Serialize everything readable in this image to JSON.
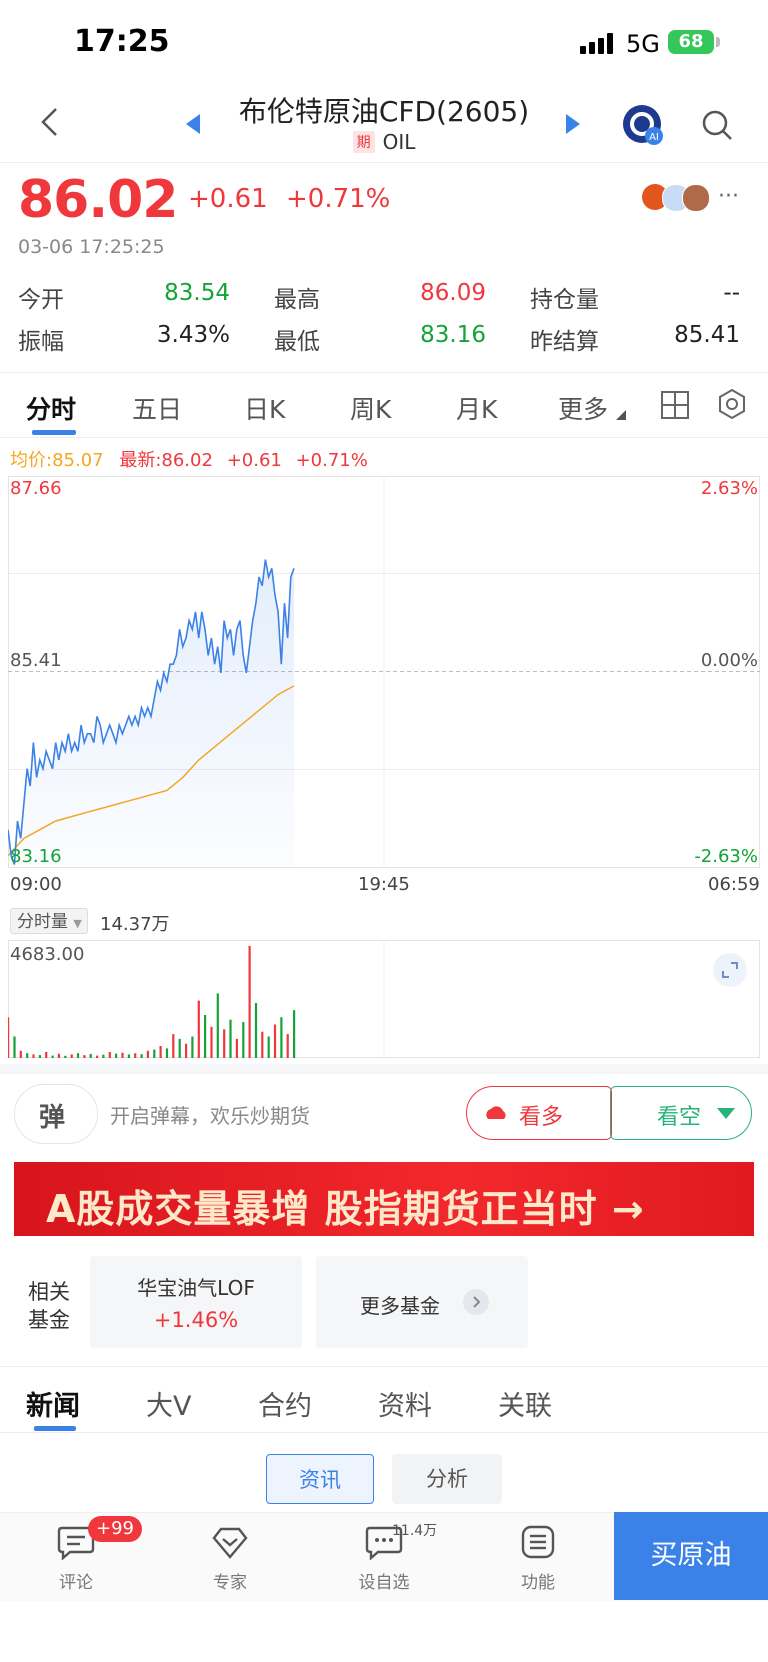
{
  "status_bar": {
    "time": "17:25",
    "network": "5G",
    "battery": "68"
  },
  "header": {
    "title": "布伦特原油CFD(2605)",
    "badge": "期",
    "code": "OIL"
  },
  "quote": {
    "price": "86.02",
    "change": "+0.61",
    "change_pct": "+0.71%",
    "time": "03-06 17:25:25",
    "stats": [
      {
        "label": "今开",
        "value": "83.54",
        "color": "#13a336"
      },
      {
        "label": "最高",
        "value": "86.09",
        "color": "#f0373c"
      },
      {
        "label": "持仓量",
        "value": "--",
        "color": "#222222"
      },
      {
        "label": "振幅",
        "value": "3.43%",
        "color": "#222222"
      },
      {
        "label": "最低",
        "value": "83.16",
        "color": "#13a336"
      },
      {
        "label": "昨结算",
        "value": "85.41",
        "color": "#222222"
      }
    ]
  },
  "chart_tabs": [
    "分时",
    "五日",
    "日K",
    "周K",
    "月K",
    "更多"
  ],
  "chart_legend": {
    "avg": "均价:85.07",
    "latest": "最新:86.02",
    "change": "+0.61",
    "change_pct": "+0.71%"
  },
  "chart_data": {
    "type": "line",
    "y_ticks_left": [
      "87.66",
      "85.41",
      "83.16"
    ],
    "y_ticks_right": [
      "2.63%",
      "0.00%",
      "-2.63%"
    ],
    "x_ticks": [
      "09:00",
      "19:45",
      "06:59"
    ],
    "ylim": [
      83.16,
      87.66
    ],
    "reference_line": 85.41,
    "series": [
      {
        "name": "最新",
        "color": "#3b82e8",
        "x": [
          0,
          1,
          2,
          3,
          4,
          5,
          6,
          7,
          8,
          9,
          10,
          11,
          12,
          13,
          14,
          15,
          16,
          17,
          18,
          19,
          20,
          21,
          22,
          23,
          24,
          25,
          26,
          27,
          28,
          29,
          30,
          31,
          32,
          33,
          34,
          35,
          36,
          37,
          38,
          39,
          40,
          41,
          42,
          43,
          44,
          45,
          46,
          47,
          48,
          49,
          50,
          51,
          52,
          53,
          54,
          55,
          56,
          57,
          58,
          59,
          60,
          61,
          62,
          63,
          64,
          65,
          66,
          67,
          68,
          69,
          70,
          71,
          72,
          73,
          74,
          75,
          76,
          77,
          78,
          79,
          80,
          81,
          82,
          83,
          84,
          85,
          86,
          87,
          88,
          89,
          90
        ],
        "values": [
          83.6,
          83.3,
          83.2,
          83.7,
          83.5,
          83.9,
          84.3,
          84.1,
          84.6,
          84.2,
          84.4,
          84.3,
          84.5,
          84.4,
          84.3,
          84.6,
          84.4,
          84.6,
          84.5,
          84.7,
          84.5,
          84.6,
          84.5,
          84.8,
          84.6,
          84.7,
          84.7,
          84.6,
          84.9,
          84.8,
          84.6,
          84.7,
          84.8,
          84.7,
          84.6,
          84.8,
          84.7,
          84.8,
          84.9,
          84.8,
          84.9,
          84.8,
          85.0,
          84.9,
          85.0,
          84.9,
          85.1,
          85.3,
          85.2,
          85.4,
          85.3,
          85.5,
          85.5,
          85.6,
          85.9,
          85.7,
          85.8,
          86.0,
          85.9,
          86.1,
          85.8,
          86.1,
          85.9,
          85.6,
          85.8,
          85.5,
          85.7,
          85.4,
          86.0,
          85.8,
          85.9,
          85.6,
          85.9,
          86.0,
          85.6,
          85.4,
          85.7,
          86.0,
          86.2,
          86.5,
          86.4,
          86.7,
          86.5,
          86.6,
          86.3,
          86.1,
          85.5,
          86.2,
          85.8,
          86.5,
          86.6
        ]
      },
      {
        "name": "均价",
        "color": "#f5a623",
        "x": [
          0,
          5,
          10,
          15,
          20,
          25,
          30,
          35,
          40,
          45,
          50,
          55,
          60,
          65,
          70,
          75,
          80,
          85,
          90
        ],
        "values": [
          83.3,
          83.5,
          83.6,
          83.7,
          83.75,
          83.8,
          83.85,
          83.9,
          83.95,
          84.0,
          84.05,
          84.2,
          84.4,
          84.55,
          84.7,
          84.85,
          85.0,
          85.15,
          85.25
        ]
      }
    ]
  },
  "volume": {
    "selector": "分时量",
    "total": "14.37万",
    "max_label": "4683.00",
    "x": [
      0,
      2,
      4,
      6,
      8,
      10,
      12,
      14,
      16,
      18,
      20,
      22,
      24,
      26,
      28,
      30,
      32,
      34,
      36,
      38,
      40,
      42,
      44,
      46,
      48,
      50,
      52,
      54,
      56,
      58,
      60,
      62,
      64,
      66,
      68,
      70,
      72,
      74,
      76,
      78,
      80,
      82,
      84,
      86,
      88,
      90
    ],
    "values": [
      1700,
      900,
      300,
      200,
      150,
      120,
      250,
      100,
      180,
      90,
      150,
      200,
      120,
      170,
      100,
      140,
      250,
      180,
      220,
      150,
      200,
      160,
      300,
      350,
      500,
      400,
      1000,
      800,
      600,
      900,
      2400,
      1800,
      1300,
      2700,
      1200,
      1600,
      800,
      1500,
      4683,
      2300,
      1100,
      900,
      1400,
      1700,
      1000,
      2000
    ]
  },
  "danmu": {
    "icon_text": "弹",
    "placeholder": "开启弹幕，欢乐炒期货"
  },
  "trade": {
    "long": "看多",
    "short": "看空"
  },
  "banner": {
    "text": "A股成交量暴增 股指期货正当时 →"
  },
  "funds": {
    "label": "相关基金",
    "item_name": "华宝油气LOF",
    "item_change": "+1.46%",
    "more": "更多基金"
  },
  "news_tabs": [
    "新闻",
    "大V",
    "合约",
    "资料",
    "关联"
  ],
  "sub_tabs": [
    "资讯",
    "分析"
  ],
  "bottom_bar": {
    "comment": "评论",
    "comment_badge": "+99",
    "expert": "专家",
    "watchlist": "设自选",
    "watchlist_count": "11.4万",
    "function": "功能",
    "buy": "买原油"
  },
  "colors": {
    "up": "#f0373c",
    "down": "#13a336",
    "accent": "#3b82e8",
    "avg_line": "#f5a623"
  }
}
